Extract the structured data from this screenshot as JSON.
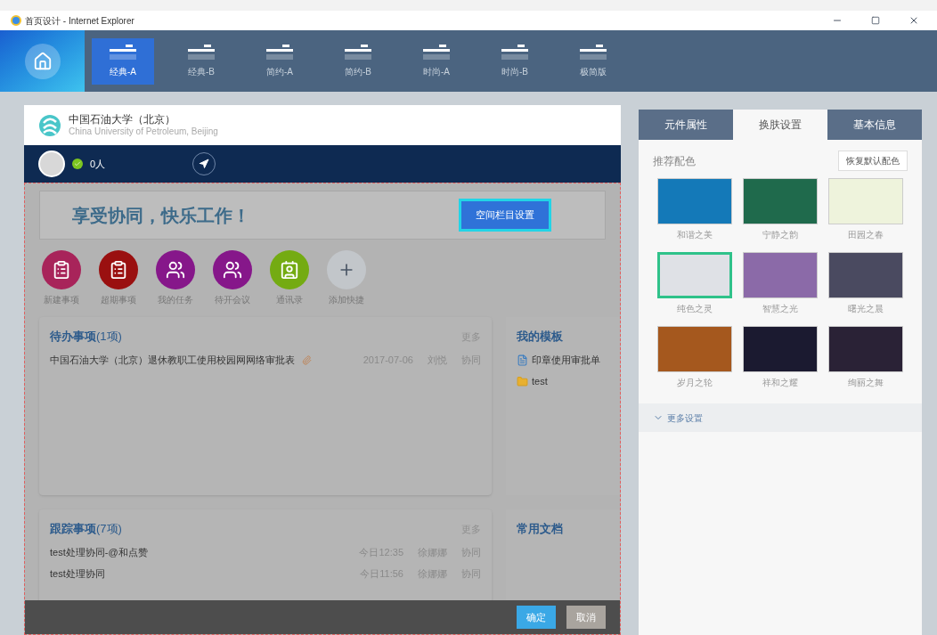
{
  "window": {
    "title": "首页设计 - Internet Explorer"
  },
  "layouts": [
    {
      "label": "经典-A",
      "selected": true
    },
    {
      "label": "经典-B",
      "selected": false
    },
    {
      "label": "简约-A",
      "selected": false
    },
    {
      "label": "简约-B",
      "selected": false
    },
    {
      "label": "时尚-A",
      "selected": false
    },
    {
      "label": "时尚-B",
      "selected": false
    },
    {
      "label": "极简版",
      "selected": false
    }
  ],
  "preview": {
    "org_name": "中国石油大学（北京）",
    "org_name_en": "China University of Petroleum, Beijing",
    "online_count": "0人",
    "slogan": "享受协同，快乐工作！",
    "space_button": "空间栏目设置",
    "shortcuts": [
      {
        "label": "新建事项",
        "color": "#a8245a"
      },
      {
        "label": "超期事项",
        "color": "#9a1010"
      },
      {
        "label": "我的任务",
        "color": "#86178a"
      },
      {
        "label": "待开会议",
        "color": "#86178a"
      },
      {
        "label": "通讯录",
        "color": "#74ab12"
      },
      {
        "label": "添加快捷",
        "color": "#c2c6ca"
      }
    ],
    "pending": {
      "title": "待办事项",
      "count": "(1项)",
      "more": "更多",
      "rows": [
        {
          "title": "中国石油大学（北京）退休教职工使用校园网网络审批表",
          "date": "2017-07-06",
          "person": "刘悦",
          "type": "协同"
        }
      ]
    },
    "templates": {
      "title": "我的模板",
      "items": [
        {
          "label": "印章使用审批单",
          "kind": "form"
        },
        {
          "label": "test",
          "kind": "folder"
        }
      ]
    },
    "tracking": {
      "title": "跟踪事项",
      "count": "(7项)",
      "more": "更多",
      "rows": [
        {
          "title": "test处理协同-@和点赞",
          "date": "今日12:35",
          "person": "徐娜娜",
          "type": "协同"
        },
        {
          "title": "test处理协同",
          "date": "今日11:56",
          "person": "徐娜娜",
          "type": "协同"
        }
      ]
    },
    "documents": {
      "title": "常用文档"
    },
    "confirm": "确定",
    "cancel": "取消"
  },
  "side_panel": {
    "tabs": [
      {
        "label": "元件属性",
        "selected": false
      },
      {
        "label": "换肤设置",
        "selected": true
      },
      {
        "label": "基本信息",
        "selected": false
      }
    ],
    "section_title": "推荐配色",
    "reset_button": "恢复默认配色",
    "skins": [
      {
        "label": "和谐之美",
        "color": "#1479b8",
        "selected": false
      },
      {
        "label": "宁静之韵",
        "color": "#1f6a4c",
        "selected": false
      },
      {
        "label": "田园之春",
        "color": "#eef3dc",
        "selected": false
      },
      {
        "label": "纯色之灵",
        "color": "#dfe1e6",
        "selected": true
      },
      {
        "label": "智慧之光",
        "color": "#8b6aa8",
        "selected": false
      },
      {
        "label": "曙光之晨",
        "color": "#4a4a60",
        "selected": false
      },
      {
        "label": "岁月之轮",
        "color": "#a5581e",
        "selected": false
      },
      {
        "label": "祥和之耀",
        "color": "#1b1a30",
        "selected": false
      },
      {
        "label": "绚丽之舞",
        "color": "#2a2236",
        "selected": false
      }
    ],
    "more_settings": "更多设置"
  }
}
